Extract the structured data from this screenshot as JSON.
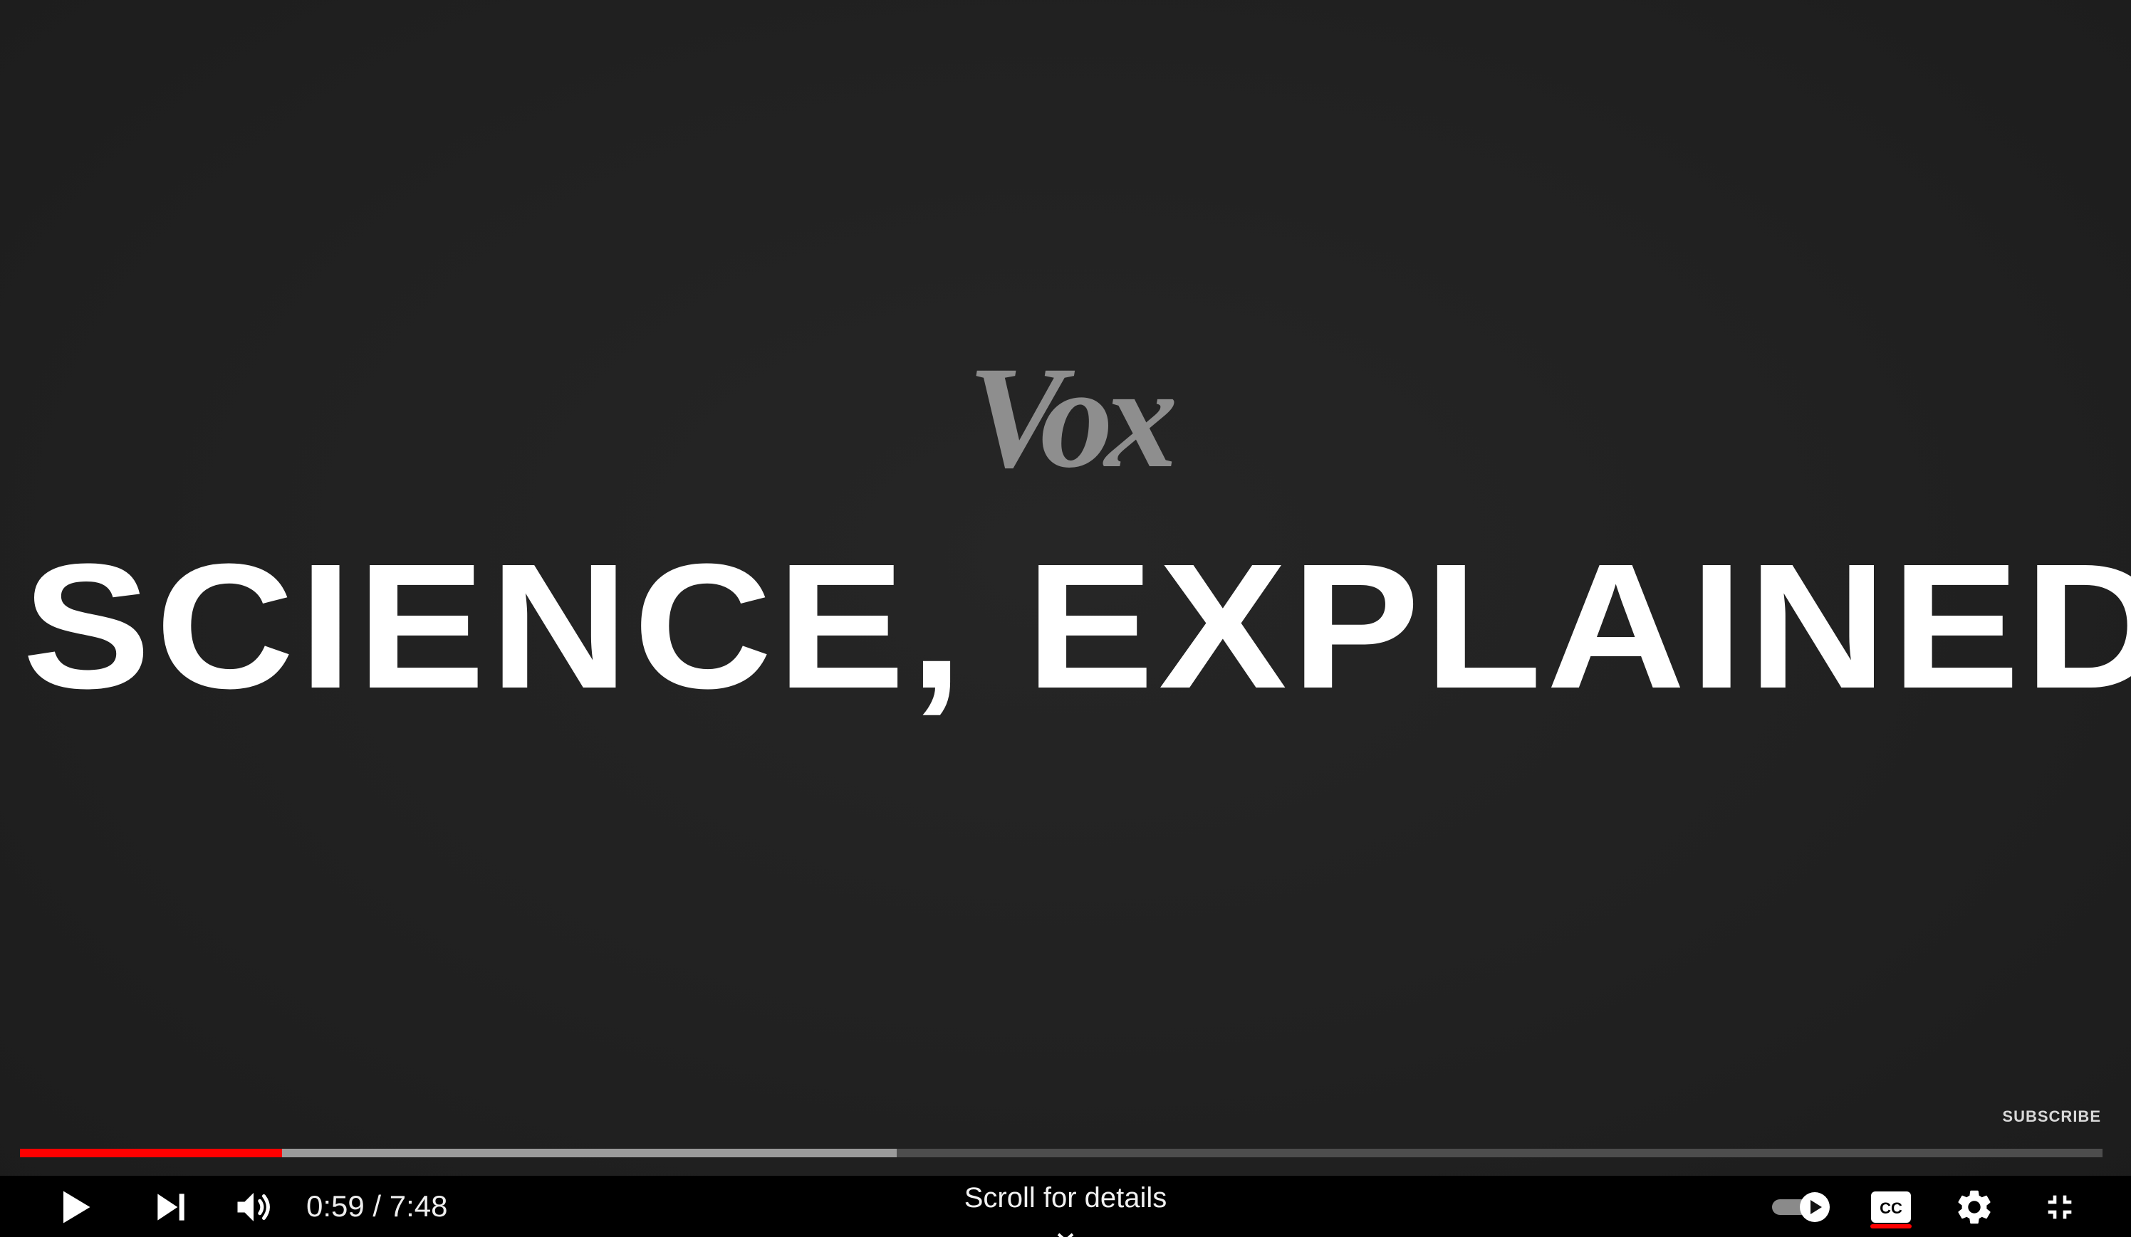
{
  "video": {
    "logo_text": "Vox",
    "headline": "SCIENCE, EXPLAINED",
    "subscribe_label": "SUBSCRIBE"
  },
  "progress": {
    "played_fraction": 0.126,
    "buffered_fraction": 0.421
  },
  "controls": {
    "play_icon": "play-icon",
    "next_icon": "next-icon",
    "volume_icon": "volume-icon",
    "time_text": "0:59 / 7:48",
    "scroll_label": "Scroll for details",
    "autoplay_icon": "autoplay-toggle-icon",
    "cc_icon": "cc-icon",
    "settings_icon": "gear-icon",
    "exit_fullscreen_icon": "exit-fullscreen-icon"
  },
  "colors": {
    "accent": "#ff0000",
    "background": "#212121",
    "logo": "#8e8e8e",
    "text": "#ffffff"
  }
}
